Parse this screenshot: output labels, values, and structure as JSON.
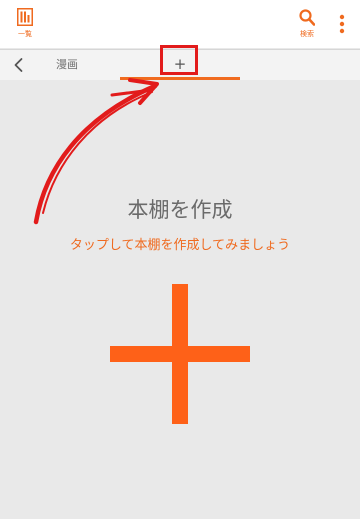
{
  "colors": {
    "accent": "#ef6a1f",
    "plus": "#fe6118",
    "annotation": "#e21b1b",
    "background": "#e9e9e9"
  },
  "topbar": {
    "list_icon": "bookshelf-icon",
    "list_label": "一覧",
    "search_icon": "search-icon",
    "search_label": "検索",
    "menu_icon": "more-vert-icon"
  },
  "tabs": {
    "back_icon": "chevron-left-icon",
    "items": [
      {
        "label": "漫画",
        "selected": false
      },
      {
        "label": "+",
        "selected": true
      }
    ]
  },
  "main": {
    "title": "本棚を作成",
    "hint": "タップして本棚を作成してみましょう",
    "add_icon": "big-plus-icon"
  }
}
